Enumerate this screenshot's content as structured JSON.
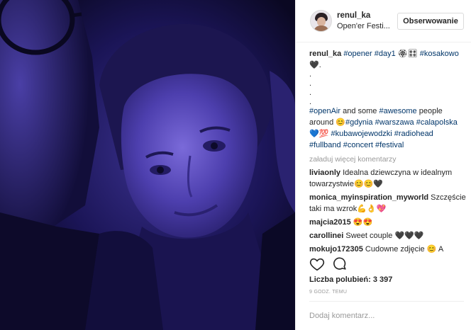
{
  "header": {
    "username": "renul_ka",
    "location": "Open'er Festi...",
    "follow_label": "Obserwowanie"
  },
  "caption": {
    "username": "renul_ka",
    "line1_tags": [
      "#opener",
      "#day1"
    ],
    "line1_after": "🏵🎛",
    "line1_tag2": "#kosakowo",
    "line1_end": "🖤.",
    "dots": [
      ".",
      ".",
      ".",
      "."
    ],
    "tag_openair": "#openAir",
    "text_and_some": " and some ",
    "tag_awesome": "#awesome",
    "text_people": " people",
    "text_around": "around 😊",
    "tag_gdynia": "#gdynia",
    "tag_warszawa": "#warszawa",
    "tag_calapolska": "#calapolska",
    "emoji_heart100": "💙💯",
    "tag_kubawojewodzki": "#kubawojewodzki",
    "tag_radiohead": "#radiohead",
    "tag_fullband": "#fullband",
    "tag_concert": "#concert",
    "tag_festival": "#festival"
  },
  "load_more_label": "załaduj więcej komentarzy",
  "comments": [
    {
      "user": "liviaonly",
      "text": "Idealna dziewczyna w idealnym towarzystwie😊😊🖤"
    },
    {
      "user": "monica_myinspiration_myworld",
      "text": "Szczęście taki ma wzrok💪👌💖"
    },
    {
      "user": "majcia2015",
      "text": "😍😍"
    },
    {
      "user": "carollinei",
      "text": "Sweet couple 🖤🖤🖤"
    },
    {
      "user": "mokujo172305",
      "text": "Cudowne zdjęcie 😊 A"
    }
  ],
  "likes": {
    "label": "Liczba polubień:",
    "count": "3 397"
  },
  "time_ago": "9 GODZ. TEMU",
  "comment_input": {
    "placeholder": "Dodaj komentarz..."
  },
  "icons": {
    "like": "heart-icon",
    "comment": "comment-bubble-icon"
  },
  "colors": {
    "hashtag": "#003569",
    "muted": "#999999",
    "photo_tint": "#1a1550"
  }
}
